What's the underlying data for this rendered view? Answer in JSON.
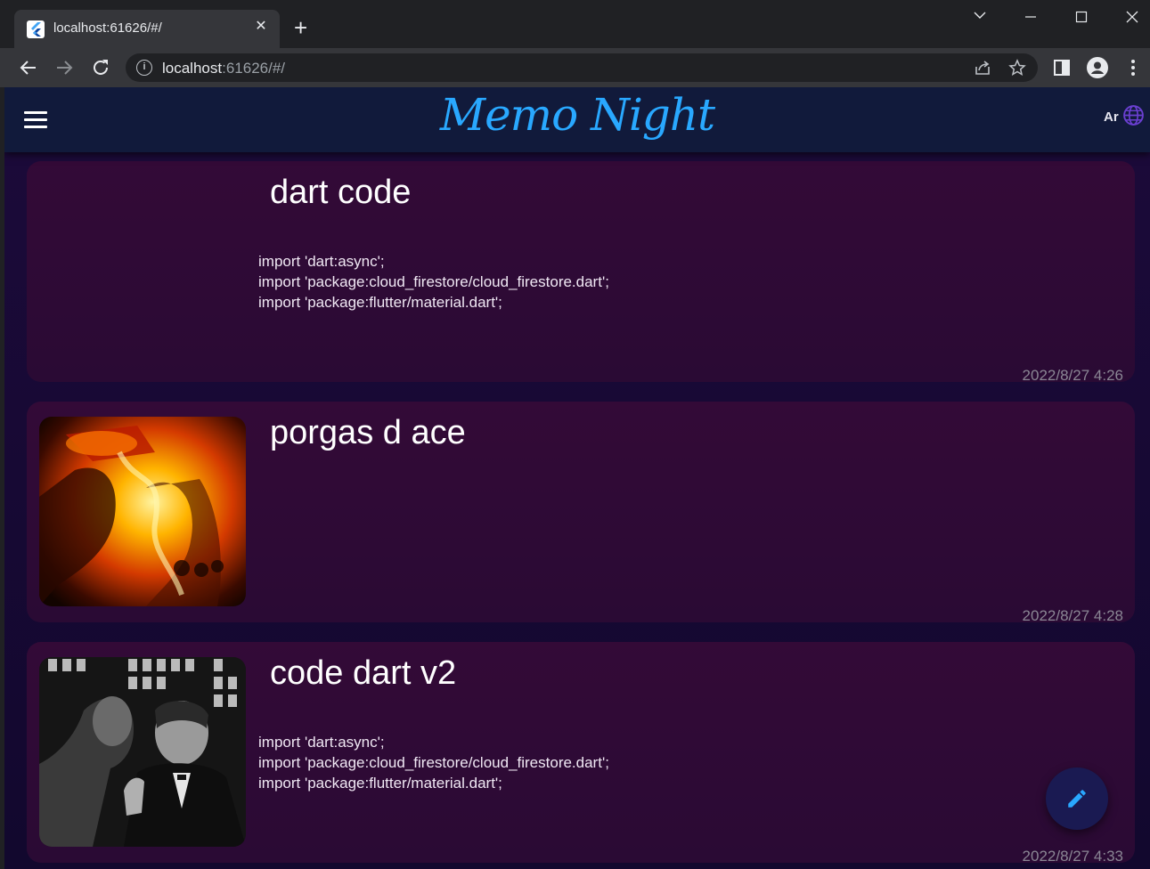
{
  "browser": {
    "tab_title": "localhost:61626/#/",
    "url_host": "localhost",
    "url_path": ":61626/#/"
  },
  "app": {
    "title": "Memo Night",
    "lang_label": "Ar",
    "accent_color": "#29a8ff"
  },
  "notes": [
    {
      "title": "dart code",
      "body": "import 'dart:async';\nimport 'package:cloud_firestore/cloud_firestore.dart';\nimport 'package:flutter/material.dart';",
      "date": "2022/8/27 4:26",
      "image": "none"
    },
    {
      "title": "porgas d ace",
      "body": "",
      "date": "2022/8/27 4:28",
      "image": "fire-character-photo"
    },
    {
      "title": "code dart v2",
      "body": "import 'dart:async';\nimport 'package:cloud_firestore/cloud_firestore.dart';\nimport 'package:flutter/material.dart';",
      "date": "2022/8/27 4:33",
      "image": "black-white-portrait-photo"
    }
  ],
  "fab": {
    "icon": "pencil-icon"
  }
}
